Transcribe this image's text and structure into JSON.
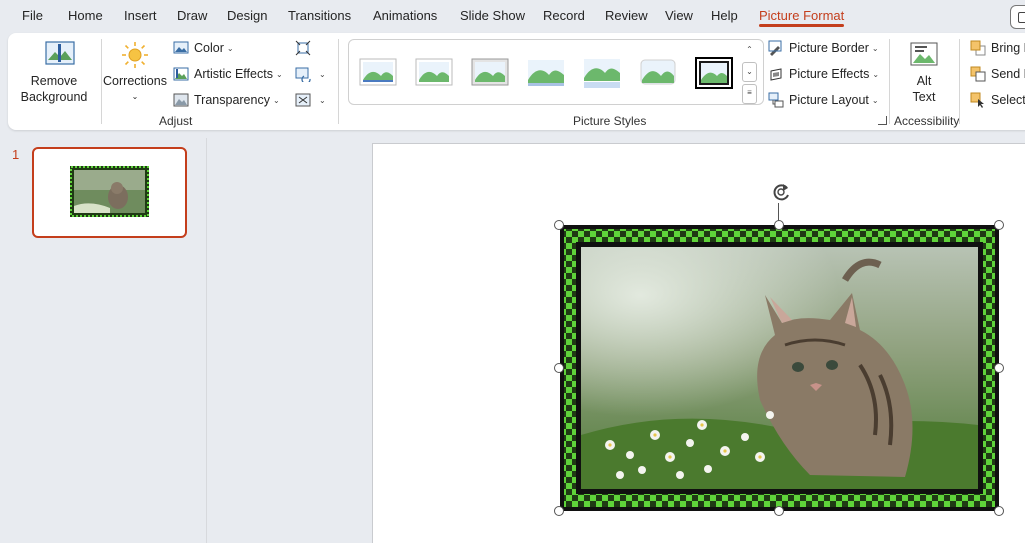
{
  "tabs": [
    {
      "label": "File",
      "active": false
    },
    {
      "label": "Home",
      "active": false
    },
    {
      "label": "Insert",
      "active": false
    },
    {
      "label": "Draw",
      "active": false
    },
    {
      "label": "Design",
      "active": false
    },
    {
      "label": "Transitions",
      "active": false
    },
    {
      "label": "Animations",
      "active": false
    },
    {
      "label": "Slide Show",
      "active": false
    },
    {
      "label": "Record",
      "active": false
    },
    {
      "label": "Review",
      "active": false
    },
    {
      "label": "View",
      "active": false
    },
    {
      "label": "Help",
      "active": false
    },
    {
      "label": "Picture Format",
      "active": true
    }
  ],
  "ribbon": {
    "adjust": {
      "label": "Adjust",
      "remove_background": "Remove Background",
      "remove_background_line1": "Remove",
      "remove_background_line2": "Background",
      "corrections": "Corrections",
      "color": "Color",
      "artistic_effects": "Artistic Effects",
      "transparency": "Transparency"
    },
    "picture_styles": {
      "label": "Picture Styles",
      "picture_border": "Picture Border",
      "picture_effects": "Picture Effects",
      "picture_layout": "Picture Layout",
      "selected_style_index": 6
    },
    "accessibility": {
      "label": "Accessibility",
      "alt_text_line1": "Alt",
      "alt_text_line2": "Text"
    },
    "arrange": {
      "bring_forward": "Bring F",
      "send_backward": "Send B",
      "selection_pane": "Selecti"
    }
  },
  "slides_panel": {
    "slide_number": "1"
  },
  "colors": {
    "accent": "#c43e1c",
    "frame_green": "#5fd33a",
    "frame_dark": "#1f3a14"
  }
}
